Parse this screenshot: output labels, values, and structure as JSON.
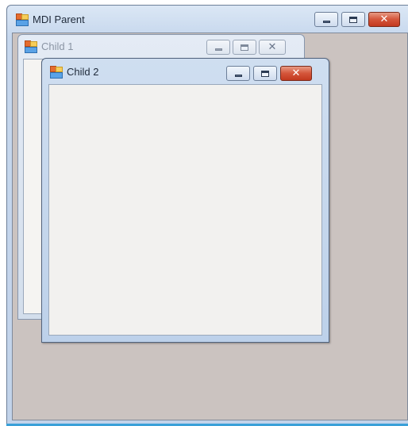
{
  "parent": {
    "title": "MDI Parent",
    "icon": "form-icon",
    "controls": {
      "minimize": "minimize-icon",
      "maximize": "maximize-icon",
      "close": "close-icon"
    }
  },
  "children": [
    {
      "title": "Child 1",
      "state": "inactive"
    },
    {
      "title": "Child 2",
      "state": "active"
    }
  ],
  "colors": {
    "mdi_background": "#cbc3c0",
    "client_area": "#f2f1ef",
    "close_button": "#c2391f",
    "frame_accent": "#3aa0d8"
  }
}
